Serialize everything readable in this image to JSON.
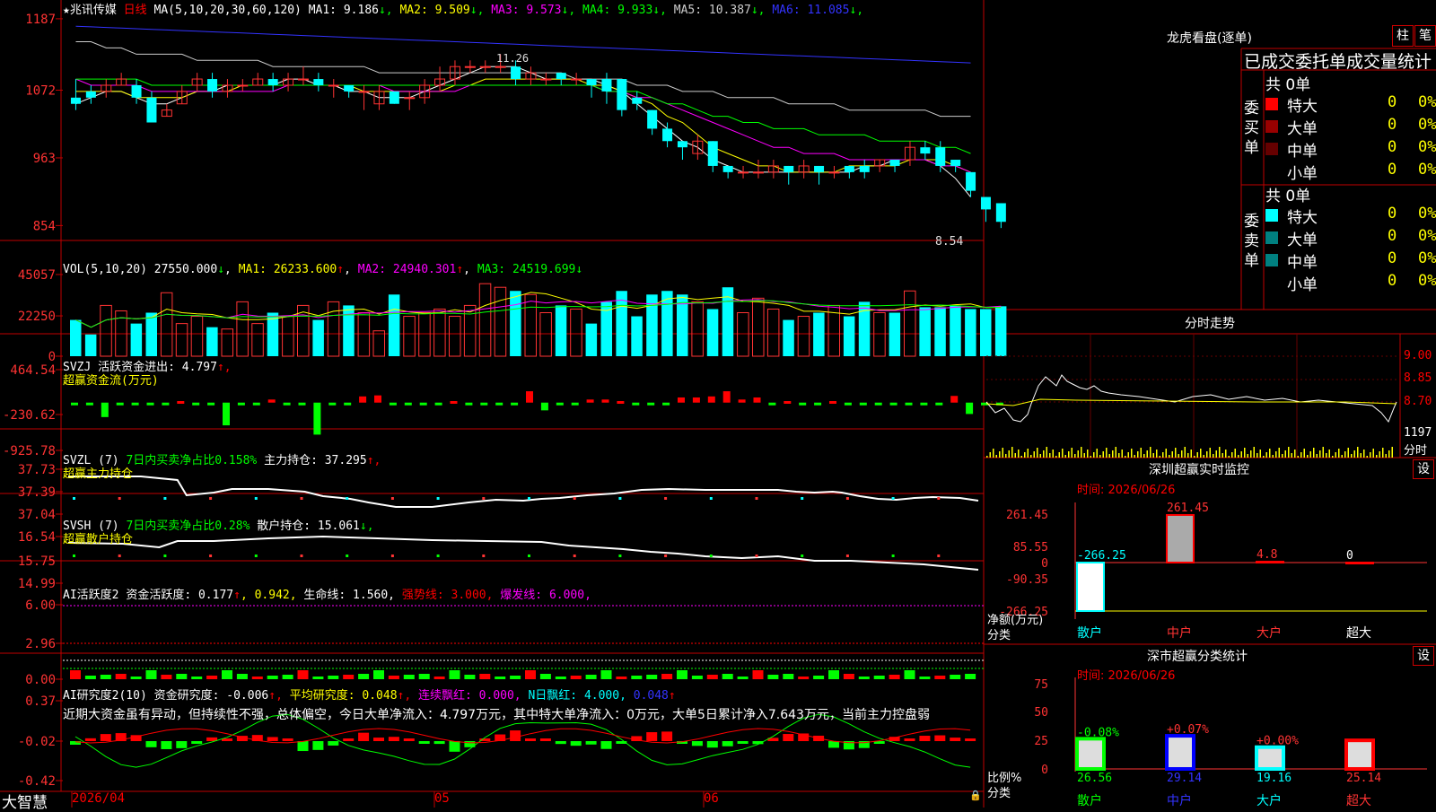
{
  "app": {
    "brand": "大智慧"
  },
  "header": {
    "stock_name": "★兆讯传媒",
    "period": "日线",
    "ma_params": "MA(5,10,20,30,60,120)",
    "ma": [
      {
        "label": "MA1:",
        "value": "9.186",
        "arrow": "↓",
        "color": "#ffffff"
      },
      {
        "label": "MA2:",
        "value": "9.509",
        "arrow": "↓",
        "color": "#ffff00"
      },
      {
        "label": "MA3:",
        "value": "9.573",
        "arrow": "↓",
        "color": "#ff00ff"
      },
      {
        "label": "MA4:",
        "value": "9.933",
        "arrow": "↓",
        "color": "#00ff00"
      },
      {
        "label": "MA5:",
        "value": "10.387",
        "arrow": "↓",
        "color": "#cccccc"
      },
      {
        "label": "MA6:",
        "value": "11.085",
        "arrow": "↓",
        "color": "#3333ff"
      }
    ],
    "high_note": "11.26",
    "low_note": "8.54"
  },
  "axes": {
    "price": [
      "1187",
      "1072",
      "963",
      "854"
    ],
    "vol": [
      "45057",
      "22250",
      "0"
    ],
    "svzj": [
      "464.54",
      "-230.62",
      "-925.78"
    ],
    "svzl": [
      "37.73",
      "37.39",
      "37.04"
    ],
    "svsh": [
      "16.54",
      "15.75",
      "14.99"
    ],
    "ai1": [
      "6.00",
      "2.96",
      "0.00"
    ],
    "ai2": [
      "0.37",
      "-0.02",
      "-0.42"
    ],
    "dates": [
      "2026/04",
      "05",
      "06"
    ]
  },
  "vol_header": {
    "name": "VOL(5,10,20)",
    "val": "27550.000",
    "a0": "↓",
    "ma1": "MA1: 26233.600",
    "a1": "↑",
    "ma2": "MA2: 24940.301",
    "a2": "↑",
    "ma3": "MA3: 24519.699",
    "a3": "↓"
  },
  "svzj_header": {
    "name": "SVZJ",
    "label": "活跃资金进出: 4.797",
    "arrow": "↑,",
    "sub": "超赢资金流(万元)"
  },
  "svzl_header": {
    "name": "SVZL (7)",
    "ratio": "7日内买卖净占比0.158%",
    "label": "主力持仓: 37.295",
    "arrow": "↑,",
    "sub": "超赢主力持仓"
  },
  "svsh_header": {
    "name": "SVSH (7)",
    "ratio": "7日内买卖净占比0.28%",
    "label": "散户持仓: 15.061",
    "arrow": "↓,",
    "sub": "超赢散户持仓"
  },
  "ai1_header": {
    "name": "AI活跃度2",
    "label": "资金活跃度: 0.177",
    "a1": "↑",
    "v2": ", 0.942,",
    "life": "生命线: 1.560,",
    "strong": "强势线: 3.000,",
    "burst": "爆发线: 6.000,"
  },
  "ai2_header": {
    "name": "AI研究度2(10)",
    "label": "资金研究度: -0.006",
    "a1": "↑,",
    "avg": "平均研究度: 0.048",
    "a2": "↑,",
    "cont": "连续飘红: 0.000,",
    "nday": "N日飘红: 4.000,",
    "v": "0.048",
    "a3": "↑"
  },
  "comment": "近期大资金虽有异动，但持续性不强，总体偏空，今日大单净流入：4.797万元，其中特大单净流入：0万元，大单5日累计净入7.643万元，当前主力控盘弱",
  "right": {
    "lhb_title": "龙虎看盘(逐单)",
    "btn_bar": "柱",
    "btn_pen": "笔",
    "tabs": [
      "已成交",
      "委托单",
      "成交量",
      "统计"
    ],
    "buy": {
      "side": [
        "委",
        "买",
        "单"
      ],
      "total": "共 0单",
      "rows": [
        {
          "label": "特大",
          "count": "0",
          "pct": "0%",
          "color": "#ff0000"
        },
        {
          "label": "大单",
          "count": "0",
          "pct": "0%",
          "color": "#990000"
        },
        {
          "label": "中单",
          "count": "0",
          "pct": "0%",
          "color": "#660000"
        },
        {
          "label": "小单",
          "count": "0",
          "pct": "0%",
          "color": ""
        }
      ]
    },
    "sell": {
      "side": [
        "委",
        "卖",
        "单"
      ],
      "total": "共 0单",
      "rows": [
        {
          "label": "特大",
          "count": "0",
          "pct": "0%",
          "color": "#00ffff"
        },
        {
          "label": "大单",
          "count": "0",
          "pct": "0%",
          "color": "#008080"
        },
        {
          "label": "中单",
          "count": "0",
          "pct": "0%",
          "color": "#008080"
        },
        {
          "label": "小单",
          "count": "0",
          "pct": "0%",
          "color": ""
        }
      ]
    },
    "fs_title": "分时走势",
    "fs_axis": [
      "9.00",
      "8.85",
      "8.70"
    ],
    "fs_vol": "1197",
    "fs_label": "分时",
    "monitor": {
      "title": "深圳超赢实时监控",
      "btn": "设",
      "time": "时间: 2026/06/26",
      "axis": [
        "261.45",
        "85.55",
        "0",
        "-90.35",
        "-266.25"
      ],
      "ylabel": "净额(万元)",
      "xlabel": "分类",
      "cats": [
        "散户",
        "中户",
        "大户",
        "超大"
      ],
      "values": [
        "-266.25",
        "261.45",
        "4.8",
        "0"
      ]
    },
    "stat": {
      "title": "深市超赢分类统计",
      "btn": "设",
      "time": "时间: 2026/06/26",
      "axis": [
        "75",
        "50",
        "25",
        "0"
      ],
      "ylabel": "比例%",
      "xlabel": "分类",
      "cats": [
        "散户",
        "中户",
        "大户",
        "超大"
      ],
      "values": [
        "26.56",
        "29.14",
        "19.16",
        "25.14"
      ],
      "changes": [
        "-0.08%",
        "+0.07%",
        "+0.00%",
        ""
      ]
    }
  },
  "chart_data": [
    {
      "type": "candlestick",
      "title": "★兆讯传媒 日线",
      "ylim": [
        8.3,
        12.1
      ],
      "candles": [
        [
          10.6,
          10.5,
          10.9,
          10.4
        ],
        [
          10.7,
          10.6,
          10.8,
          10.5
        ],
        [
          10.7,
          10.8,
          10.9,
          10.6
        ],
        [
          10.8,
          10.9,
          11.0,
          10.8
        ],
        [
          10.8,
          10.6,
          10.9,
          10.5
        ],
        [
          10.6,
          10.2,
          10.7,
          10.2
        ],
        [
          10.3,
          10.4,
          10.5,
          10.3
        ],
        [
          10.5,
          10.7,
          10.8,
          10.5
        ],
        [
          10.8,
          10.9,
          11.0,
          10.7
        ],
        [
          10.9,
          10.7,
          11.0,
          10.6
        ],
        [
          10.7,
          10.8,
          10.9,
          10.6
        ],
        [
          10.8,
          10.8,
          10.9,
          10.7
        ],
        [
          10.8,
          10.9,
          11.0,
          10.8
        ],
        [
          10.9,
          10.8,
          11.0,
          10.7
        ],
        [
          10.8,
          10.9,
          11.0,
          10.7
        ],
        [
          10.9,
          10.9,
          11.1,
          10.8
        ],
        [
          10.9,
          10.8,
          11.0,
          10.7
        ],
        [
          10.8,
          10.8,
          10.9,
          10.6
        ],
        [
          10.8,
          10.7,
          10.8,
          10.6
        ],
        [
          10.7,
          10.7,
          10.8,
          10.4
        ],
        [
          10.5,
          10.7,
          10.8,
          10.4
        ],
        [
          10.7,
          10.5,
          10.7,
          10.5
        ],
        [
          10.6,
          10.6,
          10.7,
          10.4
        ],
        [
          10.6,
          10.8,
          10.9,
          10.5
        ],
        [
          10.8,
          10.9,
          11.1,
          10.7
        ],
        [
          10.9,
          11.1,
          11.2,
          10.8
        ],
        [
          11.1,
          11.1,
          11.2,
          11.0
        ],
        [
          11.1,
          11.1,
          11.2,
          11.0
        ],
        [
          11.1,
          11.1,
          11.3,
          11.0
        ],
        [
          11.1,
          10.9,
          11.2,
          10.8
        ],
        [
          10.9,
          11.0,
          11.1,
          10.8
        ],
        [
          10.9,
          10.9,
          11.0,
          10.8
        ],
        [
          11.0,
          10.9,
          11.0,
          10.8
        ],
        [
          10.9,
          10.9,
          11.0,
          10.8
        ],
        [
          10.9,
          10.8,
          10.9,
          10.6
        ],
        [
          10.9,
          10.7,
          11.0,
          10.5
        ],
        [
          10.9,
          10.4,
          10.9,
          10.3
        ],
        [
          10.6,
          10.5,
          10.7,
          10.4
        ],
        [
          10.4,
          10.1,
          10.4,
          10.0
        ],
        [
          10.1,
          9.9,
          10.2,
          9.8
        ],
        [
          9.9,
          9.8,
          9.9,
          9.6
        ],
        [
          9.7,
          9.9,
          10.0,
          9.6
        ],
        [
          9.9,
          9.5,
          9.9,
          9.4
        ],
        [
          9.5,
          9.4,
          9.5,
          9.3
        ],
        [
          9.4,
          9.4,
          9.5,
          9.3
        ],
        [
          9.4,
          9.4,
          9.6,
          9.3
        ],
        [
          9.4,
          9.5,
          9.6,
          9.3
        ],
        [
          9.5,
          9.4,
          9.5,
          9.2
        ],
        [
          9.4,
          9.5,
          9.6,
          9.3
        ],
        [
          9.5,
          9.4,
          9.5,
          9.2
        ],
        [
          9.4,
          9.4,
          9.5,
          9.3
        ],
        [
          9.5,
          9.4,
          9.5,
          9.3
        ],
        [
          9.5,
          9.4,
          9.6,
          9.3
        ],
        [
          9.5,
          9.6,
          9.6,
          9.4
        ],
        [
          9.6,
          9.5,
          9.6,
          9.4
        ],
        [
          9.6,
          9.8,
          9.9,
          9.5
        ],
        [
          9.8,
          9.7,
          9.9,
          9.6
        ],
        [
          9.8,
          9.5,
          9.9,
          9.4
        ],
        [
          9.6,
          9.5,
          9.6,
          9.4
        ],
        [
          9.4,
          9.1,
          9.4,
          9.0
        ],
        [
          9.0,
          8.8,
          9.0,
          8.6
        ],
        [
          8.9,
          8.6,
          8.9,
          8.5
        ]
      ],
      "ma": [
        {
          "name": "MA1",
          "color": "#ffffff",
          "values": [
            10.5,
            10.6,
            10.7,
            10.7,
            10.6,
            10.5,
            10.5,
            10.6,
            10.7,
            10.7,
            10.8,
            10.8,
            10.8,
            10.8,
            10.9,
            10.9,
            10.8,
            10.8,
            10.7,
            10.7,
            10.6,
            10.6,
            10.6,
            10.7,
            10.8,
            10.9,
            11.0,
            11.1,
            11.1,
            11.1,
            11.0,
            10.9,
            10.9,
            10.9,
            10.9,
            10.8,
            10.7,
            10.5,
            10.3,
            10.1,
            9.9,
            9.8,
            9.6,
            9.5,
            9.4,
            9.4,
            9.4,
            9.4,
            9.4,
            9.4,
            9.4,
            9.4,
            9.5,
            9.5,
            9.6,
            9.6,
            9.6,
            9.5,
            9.3,
            9.0
          ]
        },
        {
          "name": "MA2",
          "color": "#ffff00",
          "values": [
            10.7,
            10.7,
            10.7,
            10.7,
            10.6,
            10.6,
            10.6,
            10.6,
            10.7,
            10.7,
            10.7,
            10.8,
            10.8,
            10.8,
            10.8,
            10.8,
            10.8,
            10.8,
            10.8,
            10.7,
            10.7,
            10.7,
            10.7,
            10.7,
            10.7,
            10.8,
            10.8,
            10.9,
            10.9,
            10.9,
            10.9,
            10.9,
            10.9,
            10.9,
            10.8,
            10.8,
            10.7,
            10.6,
            10.5,
            10.3,
            10.2,
            10.0,
            9.8,
            9.7,
            9.6,
            9.5,
            9.5,
            9.4,
            9.4,
            9.4,
            9.4,
            9.5,
            9.5,
            9.5,
            9.5,
            9.6,
            9.6,
            9.6,
            9.5,
            9.4
          ]
        },
        {
          "name": "MA3",
          "color": "#ff00ff",
          "values": [
            10.9,
            10.8,
            10.8,
            10.8,
            10.8,
            10.7,
            10.7,
            10.7,
            10.7,
            10.7,
            10.7,
            10.7,
            10.7,
            10.7,
            10.8,
            10.8,
            10.8,
            10.8,
            10.8,
            10.8,
            10.8,
            10.7,
            10.7,
            10.7,
            10.7,
            10.7,
            10.8,
            10.8,
            10.8,
            10.8,
            10.8,
            10.8,
            10.8,
            10.8,
            10.8,
            10.7,
            10.7,
            10.6,
            10.6,
            10.5,
            10.4,
            10.3,
            10.2,
            10.1,
            10.0,
            9.9,
            9.8,
            9.8,
            9.7,
            9.7,
            9.7,
            9.6,
            9.6,
            9.6,
            9.6,
            9.6,
            9.6,
            9.5,
            9.5,
            9.4
          ]
        },
        {
          "name": "MA4",
          "color": "#00ff00",
          "values": [
            10.9,
            10.9,
            10.9,
            10.9,
            10.9,
            10.8,
            10.8,
            10.8,
            10.8,
            10.8,
            10.8,
            10.8,
            10.8,
            10.8,
            10.8,
            10.8,
            10.8,
            10.8,
            10.8,
            10.8,
            10.8,
            10.8,
            10.8,
            10.8,
            10.8,
            10.8,
            10.8,
            10.8,
            10.8,
            10.8,
            10.8,
            10.8,
            10.8,
            10.8,
            10.8,
            10.7,
            10.7,
            10.7,
            10.6,
            10.5,
            10.5,
            10.4,
            10.3,
            10.3,
            10.2,
            10.2,
            10.1,
            10.1,
            10.1,
            10.0,
            10.0,
            10.0,
            10.0,
            9.9,
            9.9,
            9.9,
            9.9,
            9.8,
            9.8,
            9.7
          ]
        },
        {
          "name": "MA5",
          "color": "#cccccc",
          "values": [
            11.5,
            11.5,
            11.4,
            11.4,
            11.3,
            11.3,
            11.3,
            11.3,
            11.2,
            11.2,
            11.2,
            11.2,
            11.2,
            11.1,
            11.1,
            11.1,
            11.1,
            11.1,
            11.1,
            11.1,
            11.0,
            11.0,
            11.0,
            11.0,
            11.0,
            11.0,
            11.0,
            11.0,
            11.0,
            11.0,
            11.0,
            11.0,
            11.0,
            10.9,
            10.9,
            10.9,
            10.9,
            10.8,
            10.8,
            10.8,
            10.7,
            10.7,
            10.7,
            10.6,
            10.6,
            10.6,
            10.6,
            10.5,
            10.5,
            10.5,
            10.5,
            10.4,
            10.4,
            10.4,
            10.4,
            10.4,
            10.4,
            10.3,
            10.3,
            10.3
          ]
        },
        {
          "name": "MA6",
          "color": "#3333ff",
          "values": [
            11.75,
            11.74,
            11.73,
            11.72,
            11.71,
            11.7,
            11.69,
            11.68,
            11.67,
            11.66,
            11.65,
            11.64,
            11.63,
            11.62,
            11.61,
            11.6,
            11.59,
            11.58,
            11.57,
            11.56,
            11.55,
            11.54,
            11.53,
            11.52,
            11.51,
            11.5,
            11.49,
            11.48,
            11.47,
            11.46,
            11.45,
            11.44,
            11.43,
            11.42,
            11.41,
            11.4,
            11.39,
            11.38,
            11.37,
            11.36,
            11.35,
            11.34,
            11.33,
            11.32,
            11.31,
            11.3,
            11.29,
            11.28,
            11.27,
            11.26,
            11.25,
            11.24,
            11.23,
            11.22,
            11.21,
            11.2,
            11.19,
            11.18,
            11.17,
            11.16
          ]
        }
      ]
    },
    {
      "type": "bar",
      "name": "VOL",
      "ylim": [
        0,
        48000
      ],
      "values": [
        20000,
        12000,
        28000,
        25000,
        18000,
        24000,
        35000,
        18000,
        22000,
        16000,
        15000,
        30000,
        18000,
        24000,
        22000,
        28000,
        20000,
        30000,
        28000,
        24000,
        14000,
        34000,
        22000,
        24000,
        26000,
        22000,
        28000,
        40000,
        38000,
        36000,
        34000,
        24000,
        28000,
        26000,
        18000,
        30000,
        36000,
        22000,
        34000,
        36000,
        34000,
        30000,
        26000,
        38000,
        24000,
        32000,
        26000,
        20000,
        22000,
        24000,
        28000,
        22000,
        30000,
        24000,
        24000,
        36000,
        27000,
        27000,
        28000,
        26000,
        26000,
        27550
      ]
    },
    {
      "type": "bar",
      "name": "SVZJ",
      "ylim": [
        -925.78,
        464.54
      ],
      "values": [
        -30,
        -30,
        -280,
        -30,
        -30,
        -30,
        -30,
        30,
        -30,
        -30,
        -440,
        -30,
        -30,
        60,
        -30,
        -30,
        -620,
        -30,
        -30,
        120,
        140,
        -30,
        -30,
        -30,
        -30,
        30,
        -30,
        -30,
        -30,
        -30,
        220,
        -150,
        -30,
        -30,
        60,
        60,
        30,
        -30,
        -30,
        -30,
        100,
        100,
        120,
        220,
        60,
        100,
        -30,
        30,
        -30,
        -30,
        30,
        -30,
        -30,
        -30,
        -30,
        -30,
        -30,
        -30,
        130,
        -220,
        -30,
        -30
      ]
    }
  ]
}
